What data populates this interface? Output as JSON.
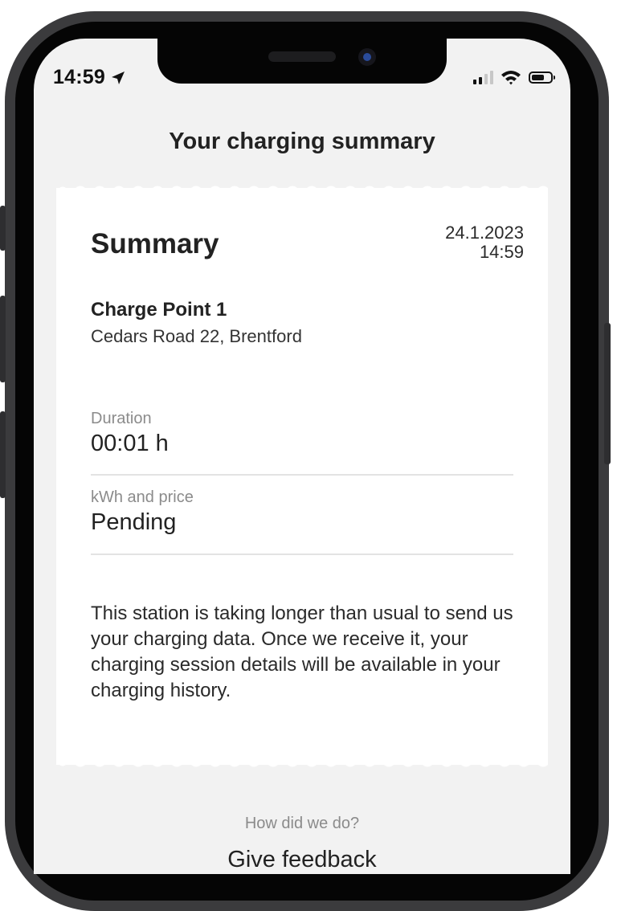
{
  "status_bar": {
    "time": "14:59",
    "location_icon": "location-arrow-icon",
    "signal_icon": "cellular-signal-icon",
    "wifi_icon": "wifi-icon",
    "battery_icon": "battery-icon"
  },
  "header": {
    "title": "Your charging summary"
  },
  "summary": {
    "title": "Summary",
    "date": "24.1.2023",
    "time": "14:59",
    "charge_point": {
      "name": "Charge Point 1",
      "address": "Cedars Road 22, Brentford"
    },
    "fields": [
      {
        "label": "Duration",
        "value": "00:01 h"
      },
      {
        "label": "kWh and price",
        "value": "Pending"
      }
    ],
    "notice": "This station is taking longer than usual to send us your charging data. Once we receive it, your charging session details will be available in your charging history."
  },
  "feedback": {
    "question": "How did we do?",
    "button_label": "Give feedback"
  },
  "colors": {
    "screen_background": "#f2f2f2",
    "card_background": "#ffffff",
    "secondary_text": "#8b8b8b"
  }
}
